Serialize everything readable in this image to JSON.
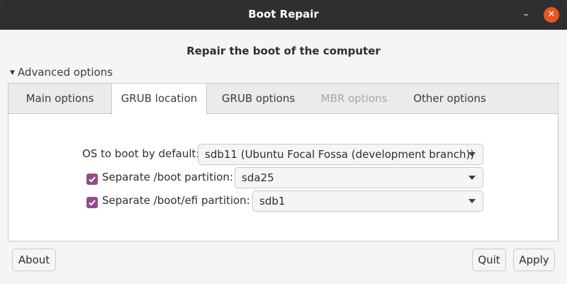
{
  "window": {
    "title": "Boot Repair",
    "minimize_glyph": "–",
    "close_glyph": "✕",
    "accent_color": "#e95420",
    "checkbox_color": "#924d8b"
  },
  "main": {
    "heading": "Repair the boot of the computer",
    "expander": {
      "arrow": "▼",
      "label": "Advanced options",
      "expanded": true
    }
  },
  "tabs": [
    {
      "label": "Main options",
      "state": "normal"
    },
    {
      "label": "GRUB location",
      "state": "active"
    },
    {
      "label": "GRUB options",
      "state": "normal"
    },
    {
      "label": "MBR options",
      "state": "disabled"
    },
    {
      "label": "Other options",
      "state": "normal"
    }
  ],
  "grub_location": {
    "os_default": {
      "label": "OS to boot by default:",
      "value": "sdb11 (Ubuntu Focal Fossa (development branch))"
    },
    "boot_partition": {
      "checked": true,
      "label": "Separate /boot partition:",
      "value": "sda25"
    },
    "efi_partition": {
      "checked": true,
      "label": "Separate /boot/efi partition:",
      "value": "sdb1"
    }
  },
  "buttons": {
    "about": "About",
    "quit": "Quit",
    "apply": "Apply"
  },
  "icons": {
    "minimize": "minimize-icon",
    "close": "close-icon",
    "expander": "triangle-down-icon",
    "dropdown": "chevron-down-icon",
    "checkbox": "checkmark-icon"
  }
}
